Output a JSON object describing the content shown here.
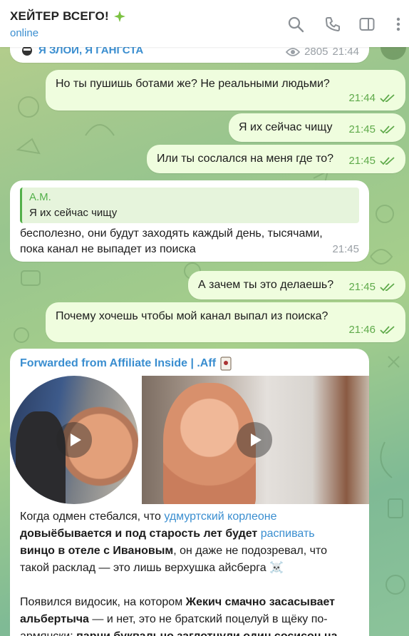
{
  "header": {
    "title": "ХЕЙТЕР ВСЕГО!",
    "status": "online",
    "title_icon": "green-sparkle-icon"
  },
  "top_partial": {
    "channel": "Я ЗЛОЙ, Я ГАНГСТА",
    "views": "2805",
    "time": "21:44"
  },
  "messages": [
    {
      "text": "Но ты пушишь ботами же? Не реальными людьми?",
      "time": "21:44"
    },
    {
      "text": "Я их сейчас чищу",
      "time": "21:45"
    },
    {
      "text": "Или ты сослался на меня где то?",
      "time": "21:45"
    },
    {
      "reply_author": "A.M.",
      "reply_text": "Я их сейчас чищу",
      "text_line1": "бесполезно, они будут заходять каждый день, тысячами,",
      "text_line2": "пока канал не выпадет из поиска",
      "time": "21:45"
    },
    {
      "text": "А зачем ты это делаешь?",
      "time": "21:45"
    },
    {
      "text": "Почему хочешь чтобы мой канал выпал из поиска?",
      "time": "21:46"
    }
  ],
  "forwarded": {
    "title": "Forwarded from Affiliate Inside | .Aff",
    "p1": [
      "Когда одмен стебался, что ",
      "удмуртский корлеоне",
      "довыёбывается и под старость лет будет ",
      "распивать",
      "винцо в отеле с Ивановым",
      ", он даже не подозревал, что",
      "такой расклад — это лишь верхушка айсберга ☠️"
    ],
    "p2": [
      "Появился видосик, на котором ",
      "Жекич смачно засасывает",
      "альбертыча",
      " — и нет, это не братский поцелуй в щёку по-",
      "армянски: ",
      "парни буквально заглотнули один сосисон на"
    ]
  },
  "colors": {
    "accent_blue": "#3a8ed0",
    "check_green": "#5faa4b",
    "outgoing_bubble": "#effdde",
    "incoming_bubble": "#ffffff"
  }
}
